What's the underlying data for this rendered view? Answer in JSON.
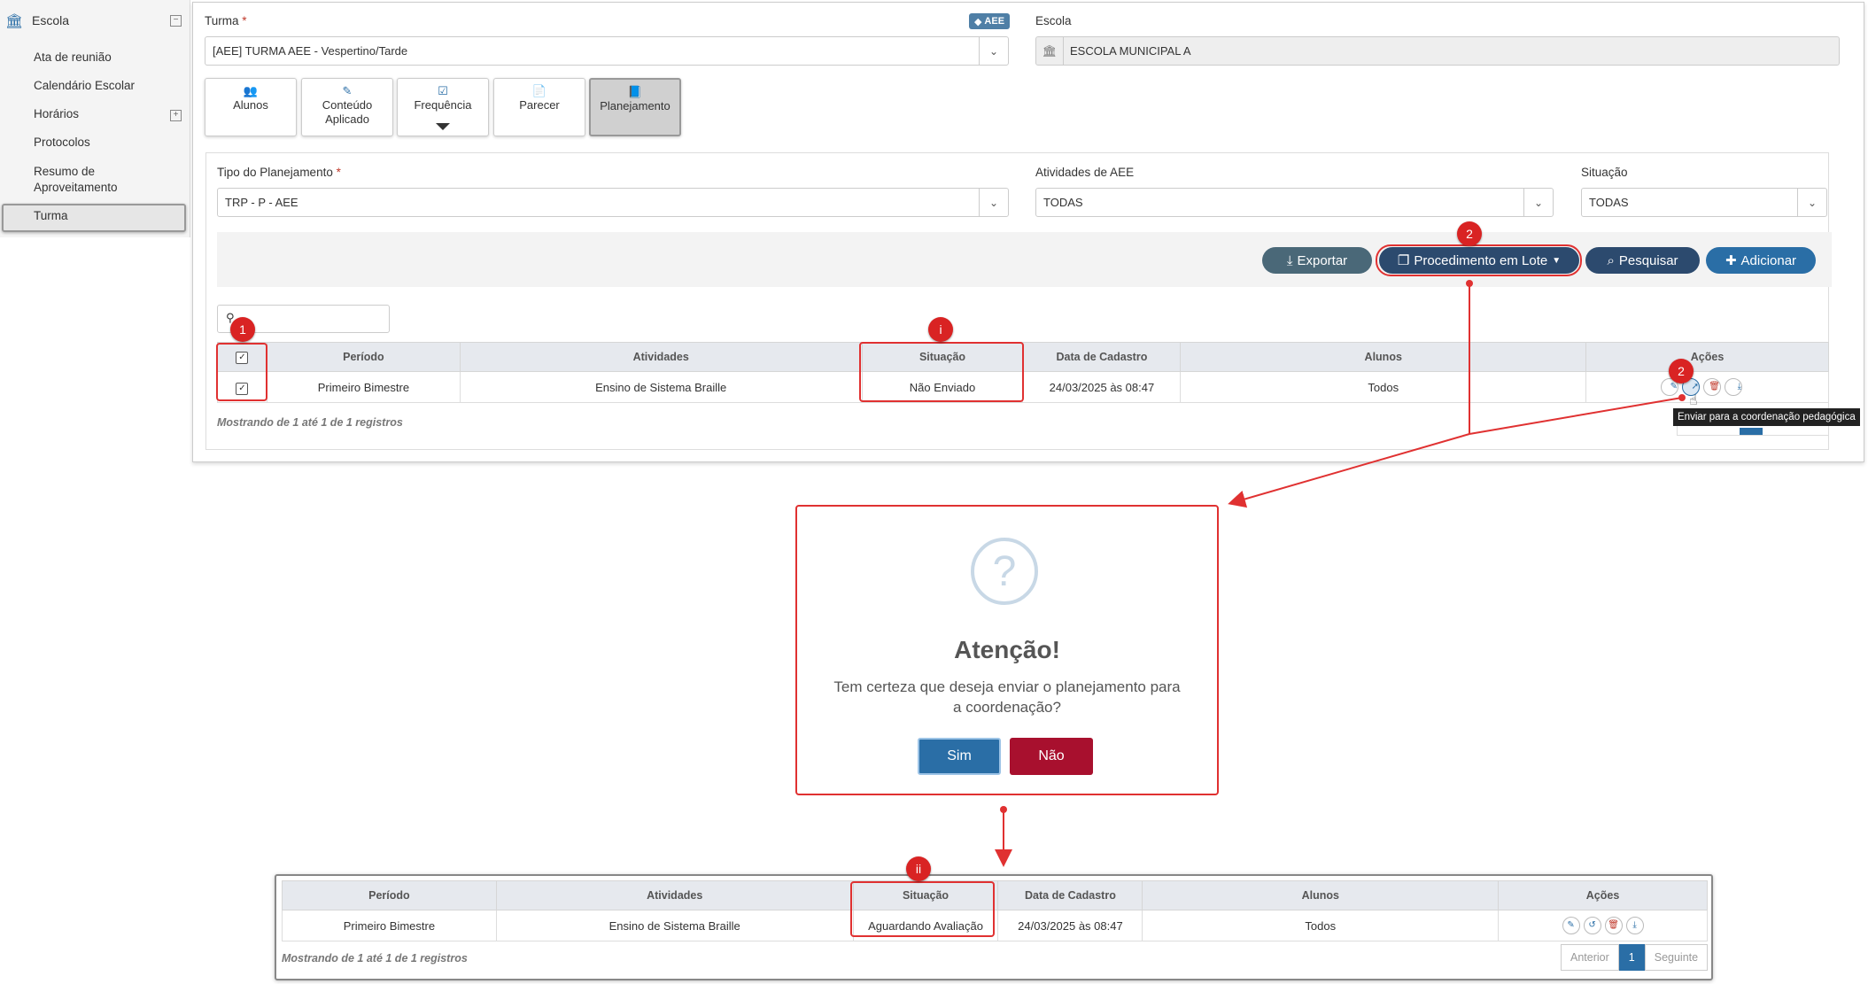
{
  "sidebar": {
    "header": "Escola",
    "items": [
      "Ata de reunião",
      "Calendário Escolar",
      "Horários",
      "Protocolos",
      "Resumo de Aproveitamento",
      "Turma"
    ]
  },
  "form": {
    "turma_label": "Turma",
    "required_mark": "*",
    "aee_badge": "AEE",
    "turma_value": "[AEE]  TURMA AEE - Vespertino/Tarde",
    "escola_label": "Escola",
    "escola_value": "ESCOLA MUNICIPAL A"
  },
  "tabs": [
    {
      "label": "Alunos",
      "icon": "users-icon"
    },
    {
      "label": "Conteúdo Aplicado",
      "icon": "magic-icon"
    },
    {
      "label": "Frequência",
      "icon": "check-square-icon"
    },
    {
      "label": "Parecer",
      "icon": "file-icon"
    },
    {
      "label": "Planejamento",
      "icon": "book-icon"
    }
  ],
  "filters": {
    "tipo_label": "Tipo do Planejamento",
    "tipo_value": "TRP - P - AEE",
    "atividades_label": "Atividades de AEE",
    "atividades_value": "TODAS",
    "situacao_label": "Situação",
    "situacao_value": "TODAS"
  },
  "toolbar": {
    "exportar": "Exportar",
    "lote": "Procedimento em Lote",
    "pesquisar": "Pesquisar",
    "adicionar": "Adicionar"
  },
  "table": {
    "columns": [
      "Período",
      "Atividades",
      "Situação",
      "Data de Cadastro",
      "Alunos",
      "Ações"
    ],
    "row": {
      "periodo": "Primeiro Bimestre",
      "atividades": "Ensino de Sistema Braille",
      "situacao": "Não Enviado",
      "data": "24/03/2025 às 08:47",
      "alunos": "Todos"
    },
    "footer": "Mostrando de 1 até 1 de 1 registros"
  },
  "tooltip": "Enviar para a coordenação pedagógica",
  "markers": {
    "m1": "1",
    "m2": "2",
    "mi": "i",
    "mii": "ii"
  },
  "dialog": {
    "icon": "?",
    "title": "Atenção!",
    "text": "Tem certeza que deseja enviar o planejamento para a coordenação?",
    "yes": "Sim",
    "no": "Não"
  },
  "result": {
    "row": {
      "periodo": "Primeiro Bimestre",
      "atividades": "Ensino de Sistema Braille",
      "situacao": "Aguardando Avaliação",
      "data": "24/03/2025 às 08:47",
      "alunos": "Todos"
    },
    "footer": "Mostrando de 1 até 1 de 1 registros",
    "pager": {
      "prev": "Anterior",
      "page": "1",
      "next": "Seguinte"
    }
  },
  "colors": {
    "red": "#e03131",
    "primary": "#2a6ea6",
    "danger": "#a8102e"
  }
}
